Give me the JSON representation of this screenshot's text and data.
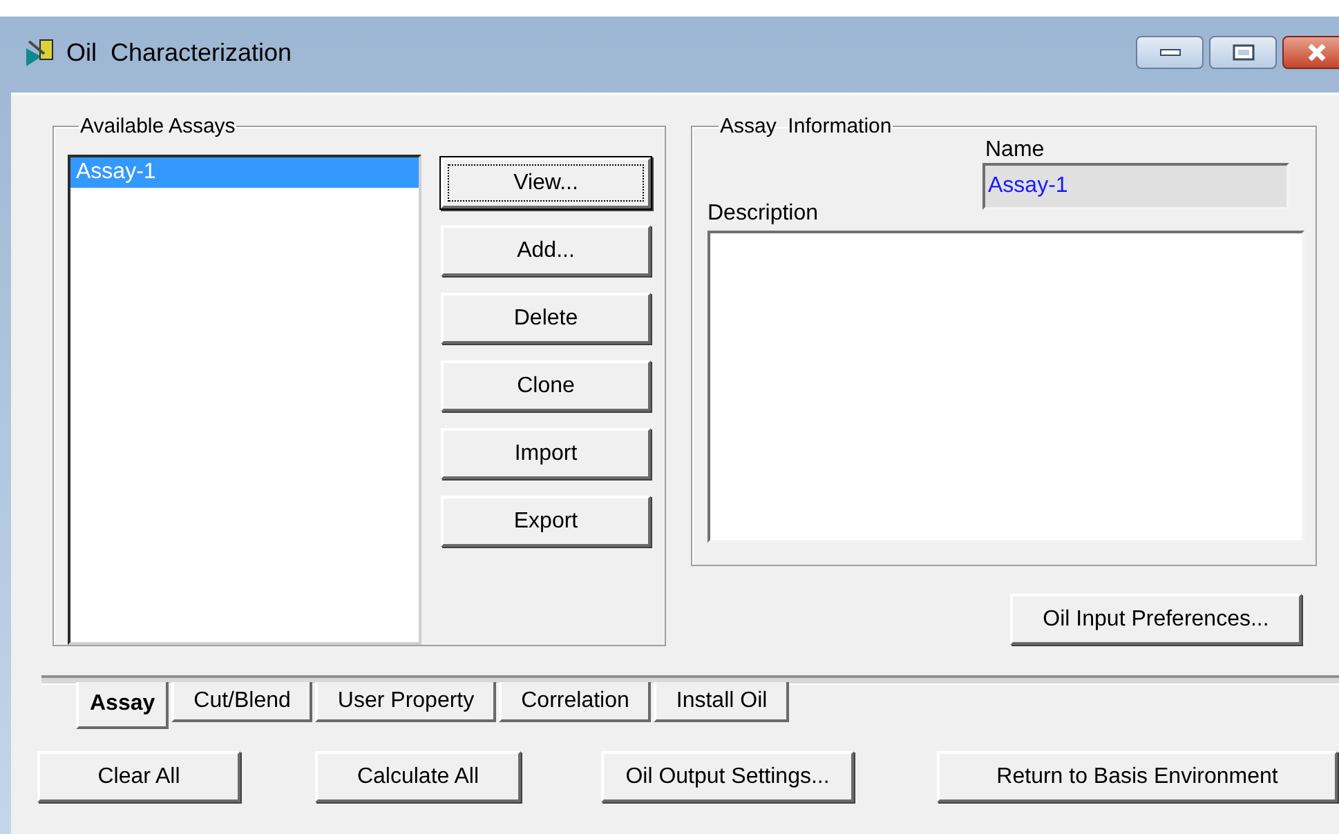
{
  "window": {
    "title": "Oil  Characterization"
  },
  "available_assays": {
    "title": "Available Assays",
    "items": [
      {
        "label": "Assay-1",
        "selected": true
      }
    ]
  },
  "assay_buttons": [
    {
      "label": "View...",
      "focused": true
    },
    {
      "label": "Add...",
      "focused": false
    },
    {
      "label": "Delete",
      "focused": false
    },
    {
      "label": "Clone",
      "focused": false
    },
    {
      "label": "Import",
      "focused": false
    },
    {
      "label": "Export",
      "focused": false
    }
  ],
  "assay_information": {
    "title": "Assay  Information",
    "name_label": "Name",
    "name_value": "Assay-1",
    "description_label": "Description"
  },
  "preferences_button": "Oil Input Preferences...",
  "tabs": [
    {
      "label": "Assay",
      "selected": true
    },
    {
      "label": "Cut/Blend",
      "selected": false
    },
    {
      "label": "User Property",
      "selected": false
    },
    {
      "label": "Correlation",
      "selected": false
    },
    {
      "label": "Install Oil",
      "selected": false
    }
  ],
  "bottom_buttons": [
    "Clear All",
    "Calculate All",
    "Oil Output Settings...",
    "Return to Basis Environment"
  ]
}
